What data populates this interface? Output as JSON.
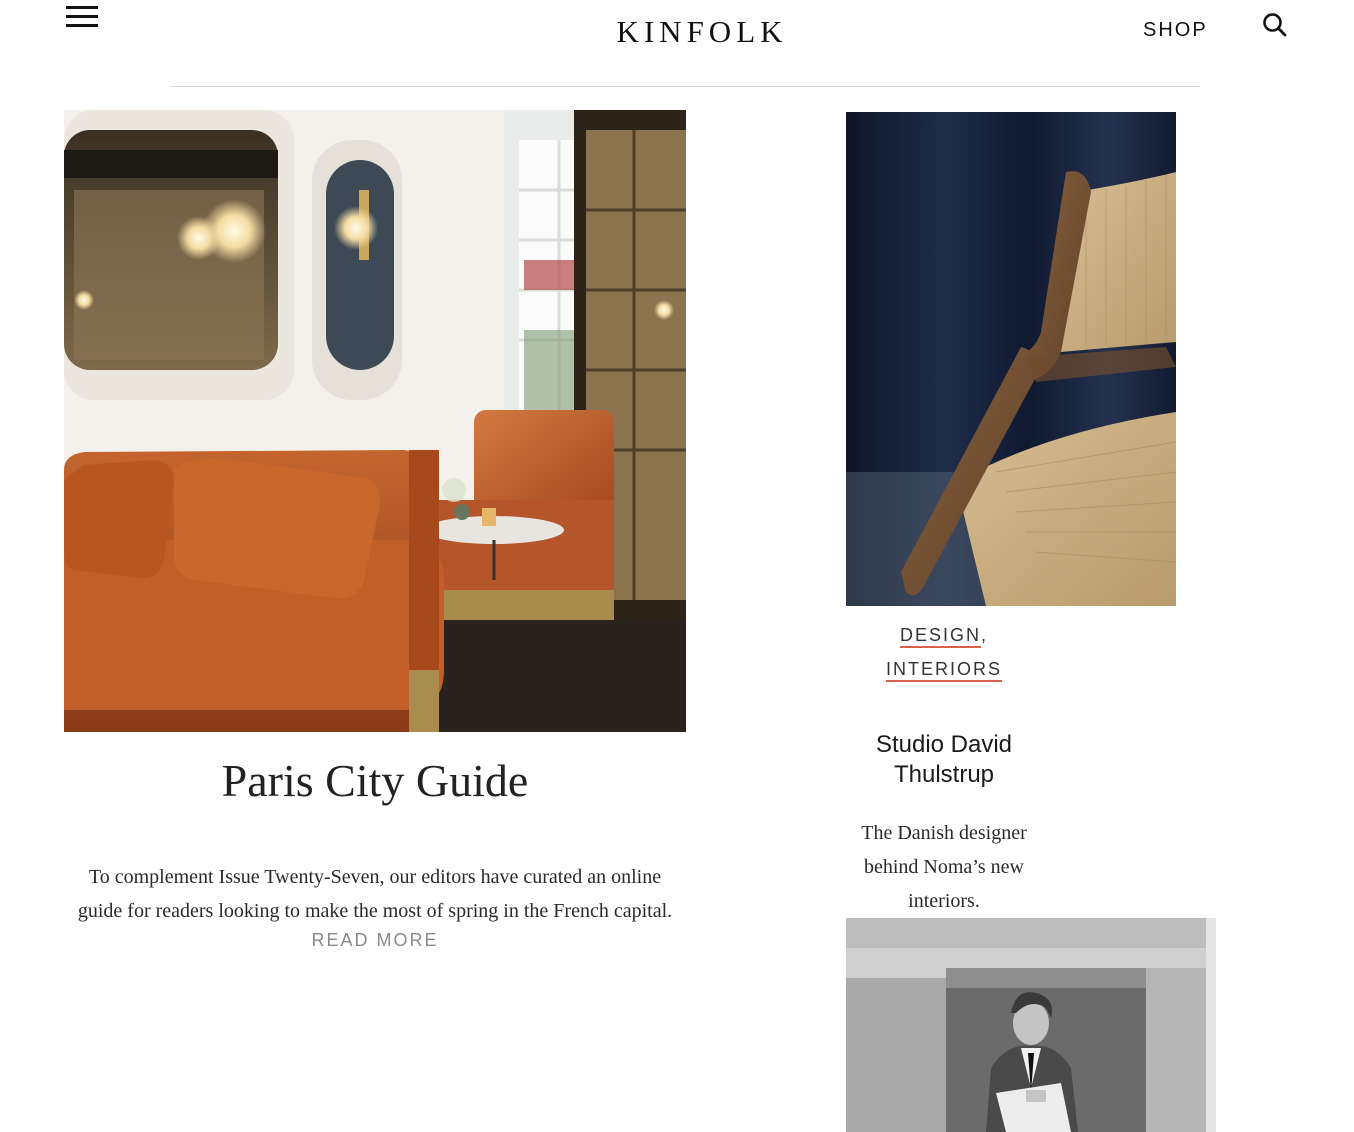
{
  "header": {
    "logo": "KINFOLK",
    "shop_label": "SHOP",
    "menu_icon": "hamburger-menu-icon",
    "search_icon": "search-icon"
  },
  "featured": {
    "image_alt": "Paris interior with orange velvet sofa",
    "title": "Paris City Guide",
    "excerpt": "To complement Issue Twenty-Seven, our editors have curated an online guide for readers looking to make the most of spring in the French capital.",
    "read_more": "READ MORE"
  },
  "side_article": {
    "image_alt": "Wooden chair with woven paper cord seat",
    "categories": [
      "DESIGN",
      "INTERIORS"
    ],
    "separator": ",",
    "title": "Studio David Thulstrup",
    "excerpt": "The Danish designer behind Noma’s new interiors."
  },
  "next_article": {
    "image_alt": "Black and white photo of man reading newspaper"
  },
  "colors": {
    "category_underline": "#d9614b",
    "rule": "#d9d9d9",
    "read_more": "#8a8a8a"
  }
}
